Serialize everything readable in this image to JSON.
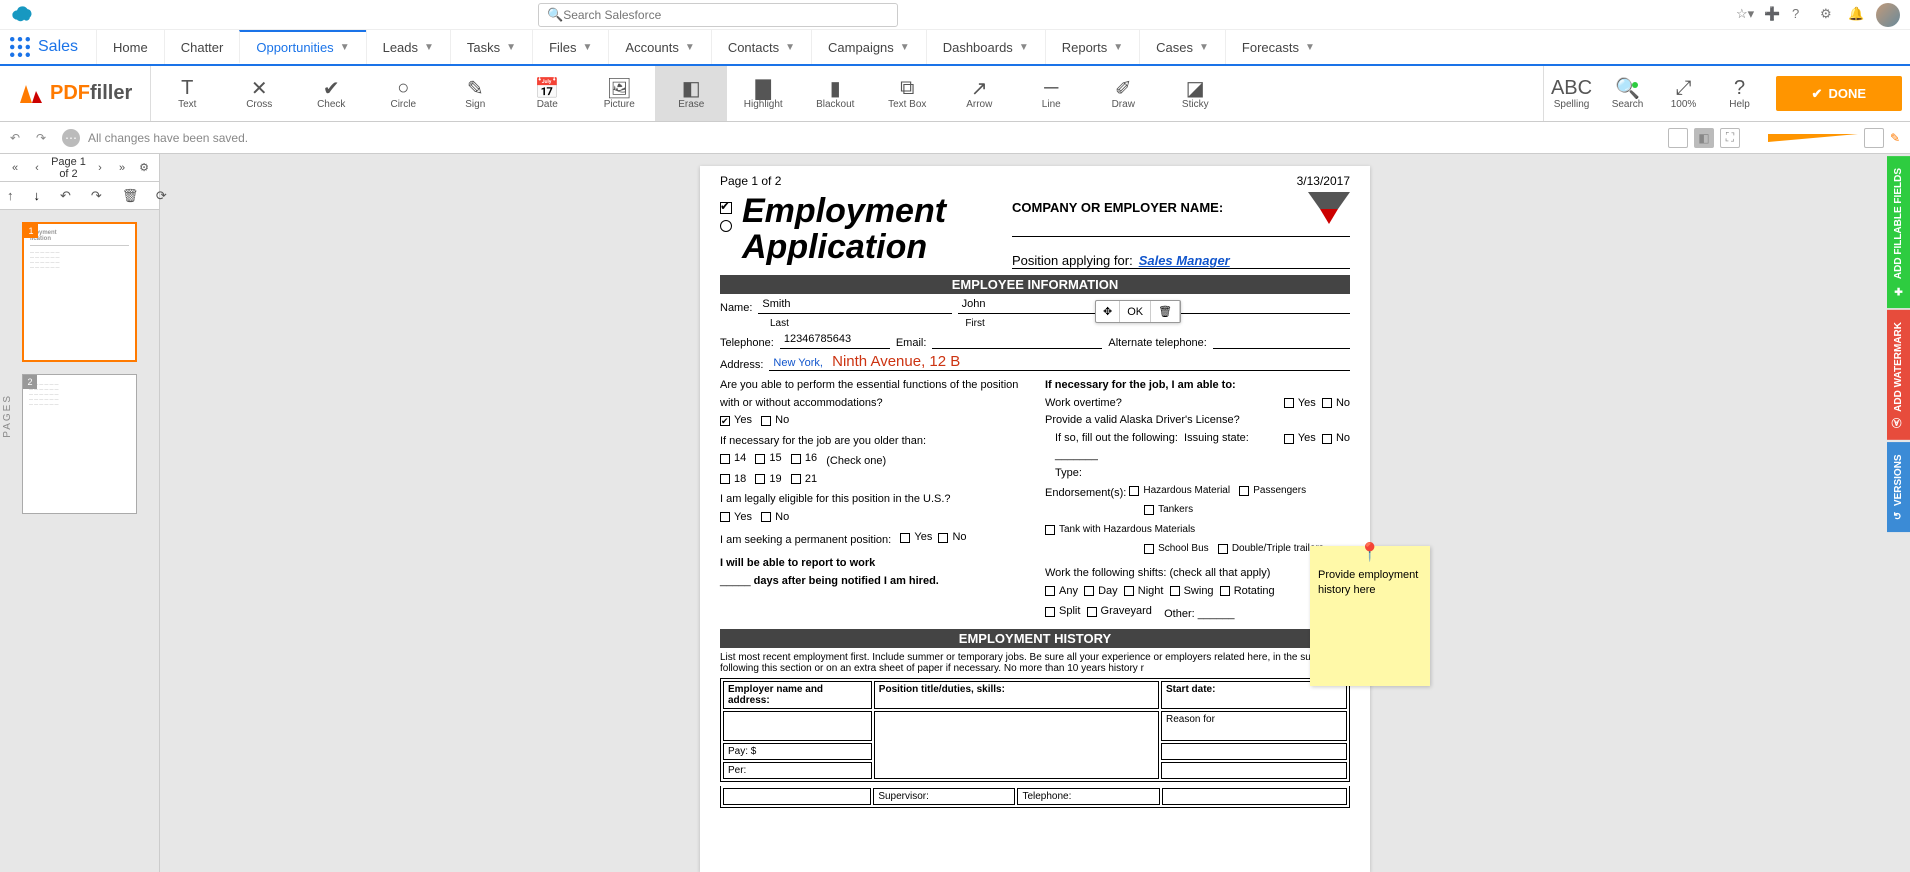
{
  "sf": {
    "search_placeholder": "Search Salesforce",
    "app": "Sales",
    "tabs": [
      "Home",
      "Chatter",
      "Opportunities",
      "Leads",
      "Tasks",
      "Files",
      "Accounts",
      "Contacts",
      "Campaigns",
      "Dashboards",
      "Reports",
      "Cases",
      "Forecasts"
    ],
    "active_tab": 2
  },
  "pf": {
    "logo_a": "PDF",
    "logo_b": "filler",
    "tools": [
      {
        "k": "text",
        "label": "Text",
        "glyph": "T"
      },
      {
        "k": "cross",
        "label": "Cross",
        "glyph": "✕"
      },
      {
        "k": "check",
        "label": "Check",
        "glyph": "✔"
      },
      {
        "k": "circle",
        "label": "Circle",
        "glyph": "○"
      },
      {
        "k": "sign",
        "label": "Sign",
        "glyph": "✎"
      },
      {
        "k": "date",
        "label": "Date",
        "glyph": "📅"
      },
      {
        "k": "picture",
        "label": "Picture",
        "glyph": "🖼"
      },
      {
        "k": "erase",
        "label": "Erase",
        "glyph": "◧"
      },
      {
        "k": "highlight",
        "label": "Highlight",
        "glyph": "▇"
      },
      {
        "k": "blackout",
        "label": "Blackout",
        "glyph": "▮"
      },
      {
        "k": "textbox",
        "label": "Text Box",
        "glyph": "⧉"
      },
      {
        "k": "arrow",
        "label": "Arrow",
        "glyph": "↗"
      },
      {
        "k": "line",
        "label": "Line",
        "glyph": "─"
      },
      {
        "k": "draw",
        "label": "Draw",
        "glyph": "✐"
      },
      {
        "k": "sticky",
        "label": "Sticky",
        "glyph": "◪"
      }
    ],
    "selected_tool": "erase",
    "right_tools": [
      {
        "k": "spelling",
        "label": "Spelling",
        "glyph": "ABC"
      },
      {
        "k": "search",
        "label": "Search",
        "glyph": "🔍"
      },
      {
        "k": "100",
        "label": "100%",
        "glyph": "⤢"
      },
      {
        "k": "help",
        "label": "Help",
        "glyph": "?"
      }
    ],
    "done": "DONE",
    "status": "All changes have been saved.",
    "page_indicator": "Page 1 of 2",
    "pages_label": "PAGES",
    "thumbs": [
      1,
      2
    ]
  },
  "doc": {
    "header_left": "Page 1 of 2",
    "header_date": "3/13/2017",
    "title_l1": "Employment",
    "title_l2": "Application",
    "company_label": "COMPANY OR EMPLOYER NAME:",
    "position_label": "Position applying for:",
    "position_value": "Sales Manager",
    "sec1": "EMPLOYEE INFORMATION",
    "name_label": "Name:",
    "name_last": "Smith",
    "name_first": "John",
    "last_lbl": "Last",
    "first_lbl": "First",
    "tel_label": "Telephone:",
    "tel_value": "12346785643",
    "email_label": "Email:",
    "alt_tel_label": "Alternate telephone:",
    "addr_label": "Address:",
    "addr_blue": "New York,",
    "addr_red": "Ninth Avenue, 12 B",
    "q_accom": "Are you able to perform the essential functions of the position with or without accommodations?",
    "yes": "Yes",
    "no": "No",
    "q_nec": "If necessary for the job, I am able to:",
    "q_ot": "Work overtime?",
    "q_dl": "Provide a valid Alaska Driver's License?",
    "q_fill": "If so, fill out the following:",
    "q_state": "Issuing state:",
    "q_age": "If necessary for the job are you older than:",
    "ages": [
      "14",
      "15",
      "16"
    ],
    "check_one": "(Check one)",
    "ages2": [
      "18",
      "19",
      "21"
    ],
    "q_type": "Type:",
    "q_end": "Endorsement(s):",
    "end_opts": [
      "Hazardous Material",
      "Passengers",
      "Tankers",
      "Tank with Hazardous Materials",
      "School Bus",
      "Double/Triple trailers"
    ],
    "q_legal": "I am legally eligible for this position in the U.S.?",
    "q_perm": "I am seeking a permanent position:",
    "q_shifts": "Work the following shifts: (check all that apply)",
    "shift_opts": [
      "Any",
      "Day",
      "Night",
      "Swing",
      "Rotating",
      "Split",
      "Graveyard"
    ],
    "shift_other": "Other:",
    "q_report_1": "I will be able to report to work",
    "q_report_2": "days after being notified I am hired.",
    "sec2": "EMPLOYMENT HISTORY",
    "hist_intro": "List most recent employment first. Include summer or temporary jobs. Be sure all your experience or employers related here, in the summary following this section or on an extra sheet of paper if necessary. No more than 10 years history r",
    "col_emp": "Employer name and address:",
    "col_pos": "Position title/duties, skills:",
    "col_start": "Start date:",
    "col_reason": "Reason for",
    "col_pay": "Pay:   $",
    "col_per": "Per:",
    "col_sup": "Supervisor:",
    "col_tel": "Telephone:",
    "popup_ok": "OK",
    "sticky_note": "Provide employment history here"
  },
  "rails": {
    "a": "ADD FILLABLE FIELDS",
    "b": "ADD WATERMARK",
    "c": "VERSIONS"
  }
}
